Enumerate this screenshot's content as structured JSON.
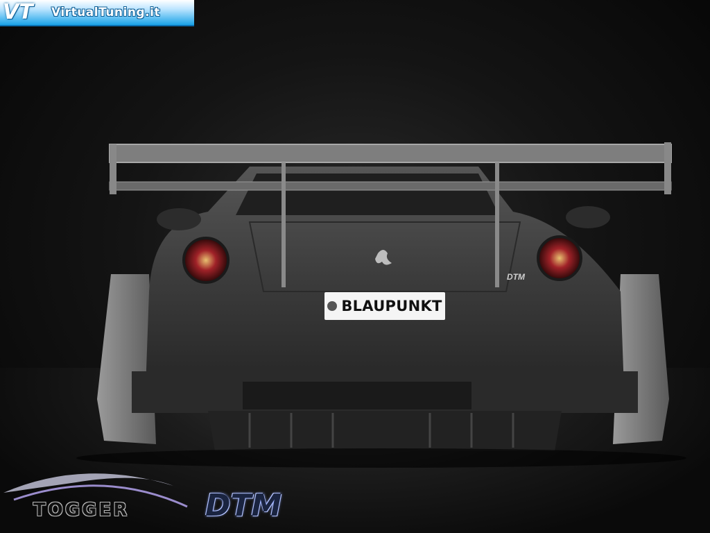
{
  "banner": {
    "logo": "VT",
    "site": "VirtualTuning.it"
  },
  "car": {
    "plate_text": "BLAUPUNKT",
    "model_badge": "DTM",
    "emblem": "prancing-horse-icon"
  },
  "footer": {
    "togger_text": "TOGGER",
    "dtm_text": "DTM"
  },
  "colors": {
    "banner_blue": "#1aa3e8",
    "body_dark": "#3a3a3a",
    "tail_light": "#c8232a"
  }
}
